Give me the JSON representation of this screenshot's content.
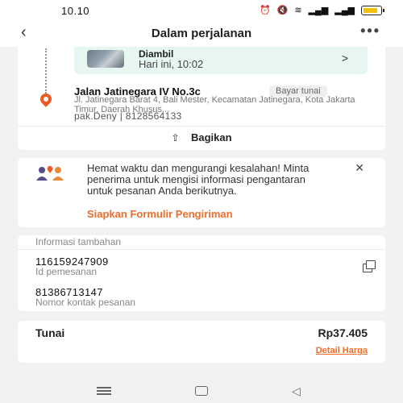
{
  "status_bar": {
    "time": "10.10",
    "icons": [
      "alarm-icon",
      "mute-icon",
      "wifi-icon",
      "signal-icon",
      "signal-icon",
      "battery-icon"
    ]
  },
  "header": {
    "title": "Dalam perjalanan",
    "back_icon": "‹",
    "more_icon": "•••"
  },
  "route": {
    "pickup": {
      "status": "Diambil",
      "time": "Hari ini, 10:02"
    },
    "destination": {
      "title": "Jalan Jatinegara IV No.3c",
      "payment_badge": "Bayar tunai",
      "address": "Jl. Jatinegara Barat 4, Bali Mester, Kecamatan Jatinegara, Kota Jakarta Timur, Daerah Khusus...",
      "contact": "pak.Deny | 8128564133"
    },
    "share_label": "Bagikan",
    "share_icon": "⇧"
  },
  "promo": {
    "text": "Hemat waktu dan mengurangi kesalahan! Minta penerima untuk mengisi informasi pengantaran untuk pesanan Anda berikutnya.",
    "link": "Siapkan Formulir Pengiriman",
    "close_icon": "✕"
  },
  "info": {
    "header": "Informasi tambahan",
    "order_id": "116159247909",
    "order_id_label": "Id pemesanan",
    "phone": "81386713147",
    "phone_label": "Nomor kontak pesanan"
  },
  "total": {
    "method": "Tunai",
    "amount": "Rp37.405",
    "detail_link": "Detail Harga"
  },
  "nav_bar": {
    "back_glyph": "◁"
  },
  "colors": {
    "accent": "#ee6d2b",
    "pin": "#ee5a24",
    "pickup_bg": "#e7f6f1",
    "battery": "#f2c200"
  }
}
